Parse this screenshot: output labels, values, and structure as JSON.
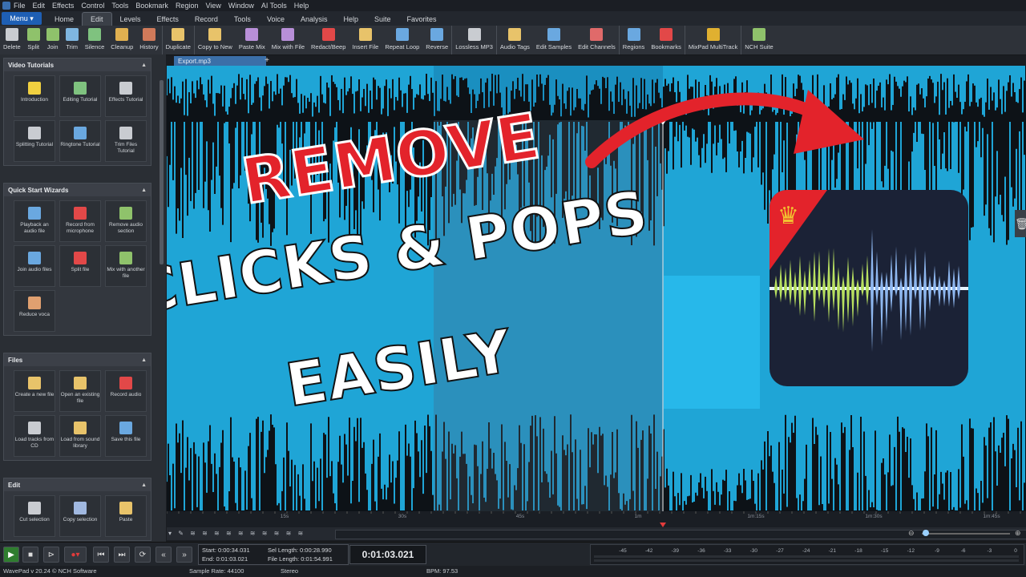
{
  "menubar": {
    "items": [
      "File",
      "Edit",
      "Effects",
      "Control",
      "Tools",
      "Bookmark",
      "Region",
      "View",
      "Window",
      "AI Tools",
      "Help"
    ]
  },
  "tabbar": {
    "menu_label": "Menu ▾",
    "tabs": [
      "Home",
      "Edit",
      "Levels",
      "Effects",
      "Record",
      "Tools",
      "Voice",
      "Analysis",
      "Help",
      "Suite",
      "Favorites"
    ],
    "active": "Edit"
  },
  "toolbar": {
    "buttons": [
      {
        "label": "Delete",
        "icon": "delete-icon",
        "color": "#c9ccd1"
      },
      {
        "label": "Split",
        "icon": "split-icon",
        "color": "#8fc26b"
      },
      {
        "label": "Join",
        "icon": "join-icon",
        "color": "#8fc26b"
      },
      {
        "label": "Trim",
        "icon": "trim-icon",
        "color": "#7fb6e0"
      },
      {
        "label": "Silence",
        "icon": "silence-icon",
        "color": "#7fc27f"
      },
      {
        "label": "Cleanup",
        "icon": "cleanup-icon",
        "color": "#e0b050"
      },
      {
        "label": "History",
        "icon": "history-icon",
        "color": "#d07a5a"
      },
      {
        "label": "Duplicate",
        "icon": "duplicate-icon",
        "color": "#e8c36a"
      },
      {
        "label": "Copy to New",
        "icon": "copy-to-new-icon",
        "color": "#e8c36a"
      },
      {
        "label": "Paste Mix",
        "icon": "paste-mix-icon",
        "color": "#b88fd8"
      },
      {
        "label": "Mix with File",
        "icon": "mix-with-file-icon",
        "color": "#b88fd8"
      },
      {
        "label": "Redact/Beep",
        "icon": "redact-beep-icon",
        "color": "#e24848"
      },
      {
        "label": "Insert File",
        "icon": "insert-file-icon",
        "color": "#e8c36a"
      },
      {
        "label": "Repeat Loop",
        "icon": "repeat-loop-icon",
        "color": "#6aa8e0"
      },
      {
        "label": "Reverse",
        "icon": "reverse-icon",
        "color": "#6aa8e0"
      },
      {
        "label": "Lossless MP3",
        "icon": "lossless-mp3-icon",
        "color": "#c9ccd1"
      },
      {
        "label": "Audio Tags",
        "icon": "audio-tags-icon",
        "color": "#e8c36a"
      },
      {
        "label": "Edit Samples",
        "icon": "edit-samples-icon",
        "color": "#6aa8e0"
      },
      {
        "label": "Edit Channels",
        "icon": "edit-channels-icon",
        "color": "#e06a6a"
      },
      {
        "label": "Regions",
        "icon": "regions-icon",
        "color": "#6aa8e0"
      },
      {
        "label": "Bookmarks",
        "icon": "bookmarks-icon",
        "color": "#e24848"
      },
      {
        "label": "MixPad MultiTrack",
        "icon": "mixpad-icon",
        "color": "#e0b030"
      },
      {
        "label": "NCH Suite",
        "icon": "nch-suite-icon",
        "color": "#8fc26b"
      }
    ]
  },
  "leftpanel": {
    "sections": [
      {
        "title": "Video Tutorials",
        "tiles": [
          {
            "label": "Introduction",
            "icon": "lightbulb-icon",
            "color": "#f0d040"
          },
          {
            "label": "Editing Tutorial",
            "icon": "editing-tutorial-icon",
            "color": "#7fc27f"
          },
          {
            "label": "Effects Tutorial",
            "icon": "effects-tutorial-icon",
            "color": "#c9ccd1"
          },
          {
            "label": "Splitting Tutorial",
            "icon": "splitting-tutorial-icon",
            "color": "#c9ccd1"
          },
          {
            "label": "Ringtone Tutorial",
            "icon": "ringtone-tutorial-icon",
            "color": "#6aa8e0"
          },
          {
            "label": "Trim Files Tutorial",
            "icon": "trim-files-tutorial-icon",
            "color": "#c9ccd1"
          }
        ]
      },
      {
        "title": "Quick Start Wizards",
        "tiles": [
          {
            "label": "Playback an audio file",
            "icon": "playback-icon",
            "color": "#6aa8e0"
          },
          {
            "label": "Record from microphone",
            "icon": "microphone-icon",
            "color": "#e24848"
          },
          {
            "label": "Remove audio section",
            "icon": "remove-section-icon",
            "color": "#8fc26b"
          },
          {
            "label": "Join audio files",
            "icon": "join-files-icon",
            "color": "#6aa8e0"
          },
          {
            "label": "Split file",
            "icon": "scissors-icon",
            "color": "#e24848"
          },
          {
            "label": "Mix with another file",
            "icon": "mix-icon",
            "color": "#8fc26b"
          },
          {
            "label": "Reduce voca",
            "icon": "reduce-vocals-icon",
            "color": "#e0a070"
          }
        ]
      },
      {
        "title": "Files",
        "tiles": [
          {
            "label": "Create a new file",
            "icon": "new-file-icon",
            "color": "#e8c36a"
          },
          {
            "label": "Open an existing file",
            "icon": "open-file-icon",
            "color": "#e8c36a"
          },
          {
            "label": "Record audio",
            "icon": "record-audio-icon",
            "color": "#e24848"
          },
          {
            "label": "Load tracks from CD",
            "icon": "cd-icon",
            "color": "#c9ccd1"
          },
          {
            "label": "Load from sound library",
            "icon": "sound-library-icon",
            "color": "#e8c36a"
          },
          {
            "label": "Save this file",
            "icon": "save-icon",
            "color": "#6aa8e0"
          }
        ]
      },
      {
        "title": "Edit",
        "tiles": [
          {
            "label": "Cut selection",
            "icon": "cut-icon",
            "color": "#c9ccd1"
          },
          {
            "label": "Copy selection",
            "icon": "copy-icon",
            "color": "#a0b8e0"
          },
          {
            "label": "Paste",
            "icon": "paste-icon",
            "color": "#e8c36a"
          }
        ]
      }
    ]
  },
  "file_tab": "Export.mp3",
  "ruler": {
    "ticks": [
      "15s",
      "30s",
      "45s",
      "1m",
      "1m:15s",
      "1m:30s",
      "1m:45s"
    ]
  },
  "overlay": {
    "line1": "REMOVE",
    "line2": "CLICKS & POPS",
    "line3": "EASILY"
  },
  "selection": {
    "start": "Start:  0:00:34.031",
    "end": "End:  0:01:03.021",
    "sel_length": "Sel Length:  0:00:28.990",
    "file_length": "File Length:  0:01:54.991",
    "cursor": "0:01:03.021"
  },
  "meter": {
    "ticks": [
      "-45",
      "-42",
      "-39",
      "-36",
      "-33",
      "-30",
      "-27",
      "-24",
      "-21",
      "-18",
      "-15",
      "-12",
      "-9",
      "-6",
      "-3",
      "0"
    ]
  },
  "statusbar": {
    "version": "WavePad v 20.24 © NCH Software",
    "sample_rate": "Sample Rate: 44100",
    "channels": "Stereo",
    "bpm": "BPM: 97.53"
  },
  "colors": {
    "wave": "#1fa5d6",
    "wave_bright": "#27b8ea",
    "selection": "#1a8fc0",
    "accent": "#1e5fb4",
    "overlay_red": "#e3232b"
  }
}
